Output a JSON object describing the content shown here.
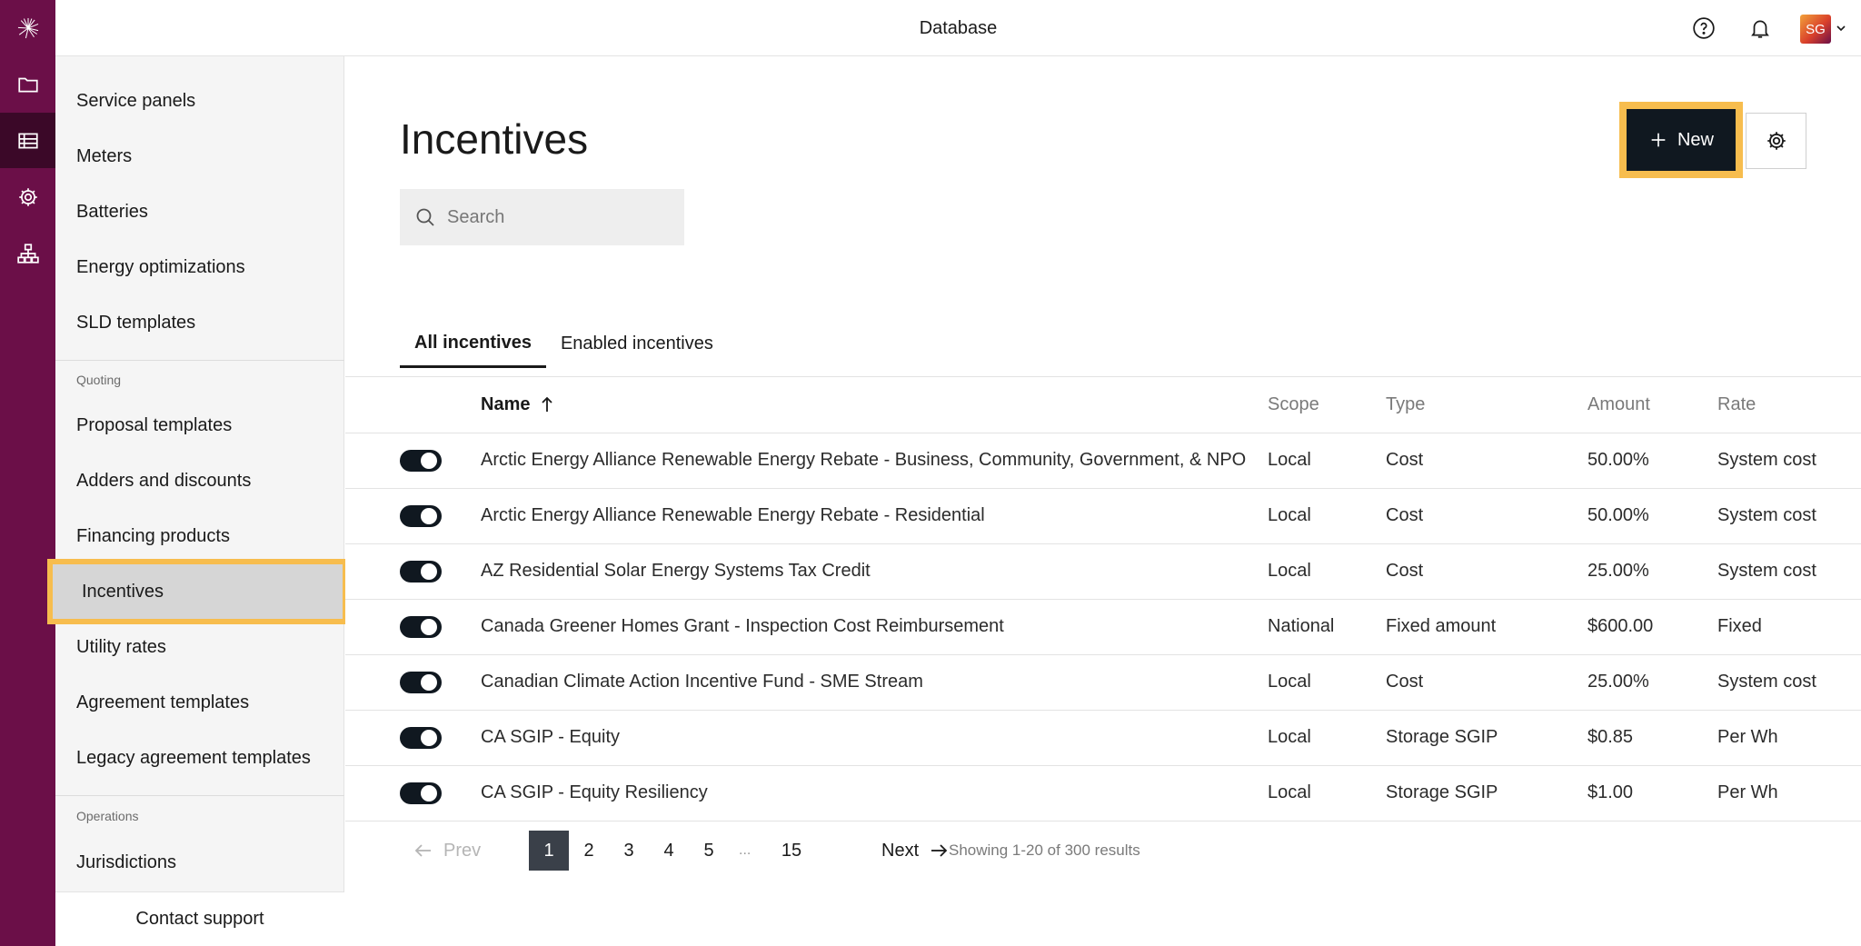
{
  "topbar": {
    "title": "Database",
    "avatar_initials": "SG"
  },
  "rail": {
    "items": [
      {
        "icon": "folder-icon"
      },
      {
        "icon": "database-table-icon",
        "active": true
      },
      {
        "icon": "gear-icon"
      },
      {
        "icon": "org-chart-icon"
      }
    ]
  },
  "sidebar": {
    "items_top": [
      "Service panels",
      "Meters",
      "Batteries",
      "Energy optimizations",
      "SLD templates"
    ],
    "quoting_label": "Quoting",
    "quoting_items": [
      "Proposal templates",
      "Adders and discounts",
      "Financing products",
      "Incentives",
      "Utility rates",
      "Agreement templates",
      "Legacy agreement templates"
    ],
    "operations_label": "Operations",
    "operations_items": [
      "Jurisdictions"
    ],
    "selected": "Incentives",
    "contact_support": "Contact support"
  },
  "main": {
    "title": "Incentives",
    "search_placeholder": "Search",
    "new_button": "New",
    "tabs": [
      {
        "label": "All incentives",
        "active": true
      },
      {
        "label": "Enabled incentives",
        "active": false
      }
    ],
    "columns": {
      "name": "Name",
      "scope": "Scope",
      "type": "Type",
      "amount": "Amount",
      "rate": "Rate"
    },
    "rows": [
      {
        "enabled": true,
        "name": "Arctic Energy Alliance Renewable Energy Rebate - Business, Community, Government, & NPO",
        "scope": "Local",
        "type": "Cost",
        "amount": "50.00%",
        "rate": "System cost"
      },
      {
        "enabled": true,
        "name": "Arctic Energy Alliance Renewable Energy Rebate - Residential",
        "scope": "Local",
        "type": "Cost",
        "amount": "50.00%",
        "rate": "System cost"
      },
      {
        "enabled": true,
        "name": "AZ Residential Solar Energy Systems Tax Credit",
        "scope": "Local",
        "type": "Cost",
        "amount": "25.00%",
        "rate": "System cost"
      },
      {
        "enabled": true,
        "name": "Canada Greener Homes Grant - Inspection Cost Reimbursement",
        "scope": "National",
        "type": "Fixed amount",
        "amount": "$600.00",
        "rate": "Fixed"
      },
      {
        "enabled": true,
        "name": "Canadian Climate Action Incentive Fund - SME Stream",
        "scope": "Local",
        "type": "Cost",
        "amount": "25.00%",
        "rate": "System cost"
      },
      {
        "enabled": true,
        "name": "CA SGIP - Equity",
        "scope": "Local",
        "type": "Storage SGIP",
        "amount": "$0.85",
        "rate": "Per Wh"
      },
      {
        "enabled": true,
        "name": "CA SGIP - Equity Resiliency",
        "scope": "Local",
        "type": "Storage SGIP",
        "amount": "$1.00",
        "rate": "Per Wh"
      }
    ],
    "pagination": {
      "prev": "Prev",
      "next": "Next",
      "pages": [
        "1",
        "2",
        "3",
        "4",
        "5"
      ],
      "ellipsis": "...",
      "last_page": "15",
      "current": "1",
      "summary": "Showing 1-20 of 300 results"
    }
  },
  "colors": {
    "rail": "#6b0f48",
    "rail_active": "#3b0828",
    "highlight": "#f7bd4e",
    "button_dark": "#101820"
  }
}
